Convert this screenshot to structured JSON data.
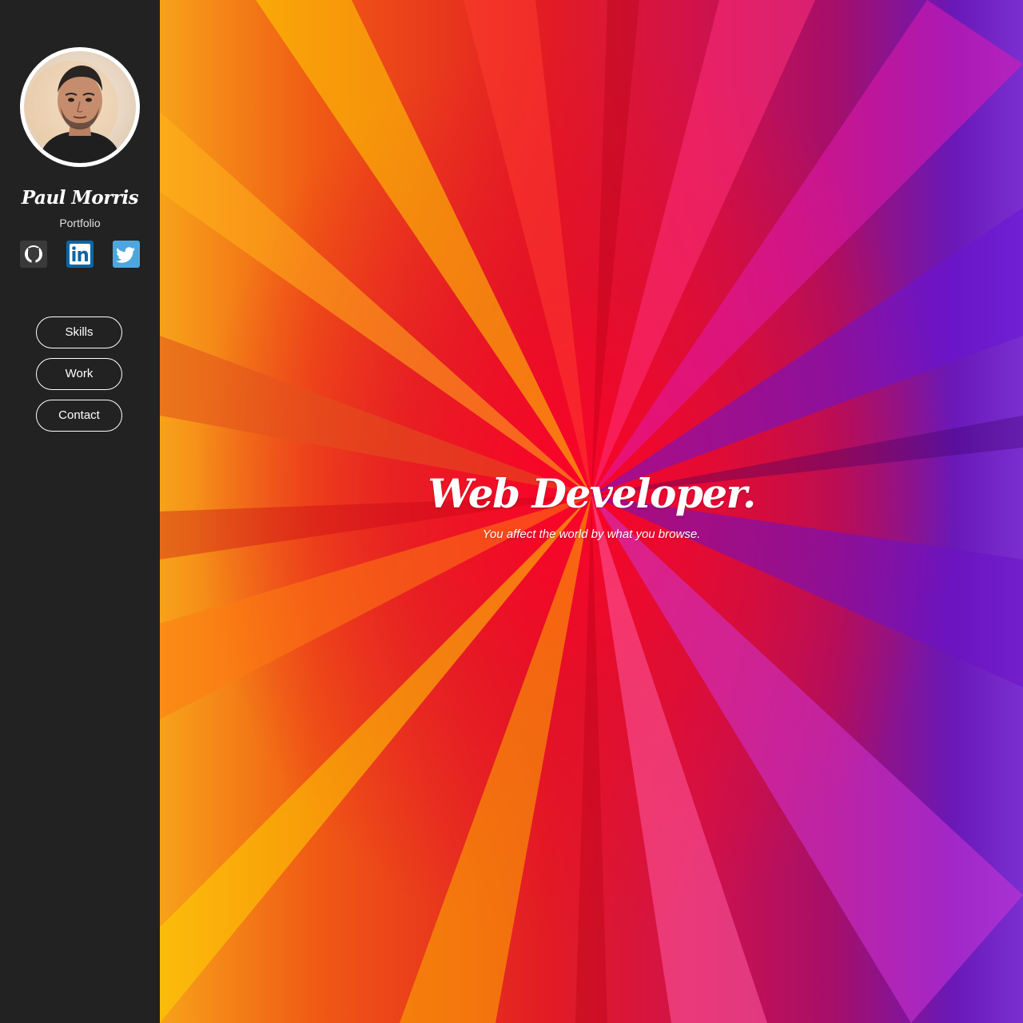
{
  "sidebar": {
    "name": "Paul Morris",
    "subtitle": "Portfolio",
    "social": [
      {
        "icon": "github-icon",
        "color": "#333333"
      },
      {
        "icon": "linkedin-icon",
        "color": "#0077b5"
      },
      {
        "icon": "twitter-icon",
        "color": "#4da7de"
      }
    ],
    "nav": [
      {
        "label": "Skills"
      },
      {
        "label": "Work"
      },
      {
        "label": "Contact"
      }
    ]
  },
  "hero": {
    "title": "Web Developer.",
    "tagline": "You affect the world by what you browse."
  },
  "colors": {
    "sidebar_bg": "#222222",
    "text": "#ffffff"
  }
}
